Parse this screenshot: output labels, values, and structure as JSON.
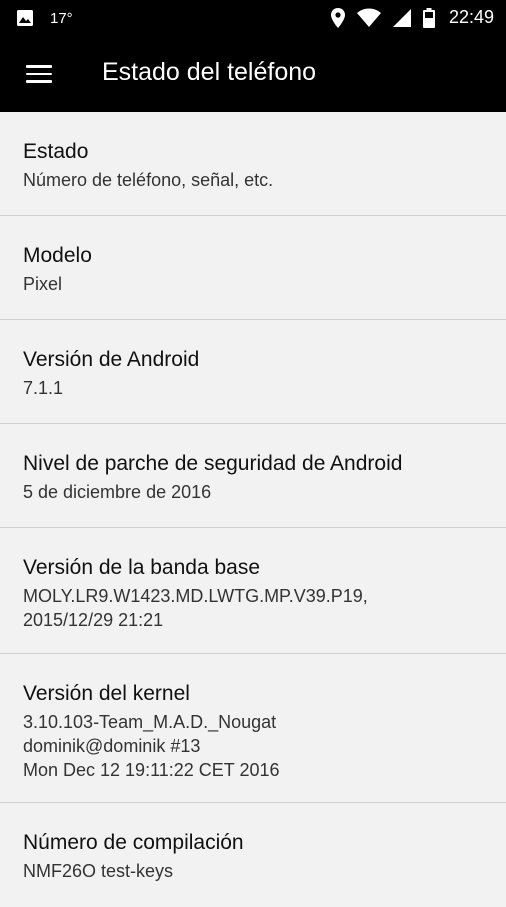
{
  "status_bar": {
    "temperature": "17°",
    "time": "22:49"
  },
  "app_bar": {
    "title": "Estado del teléfono",
    "menu_icon": "hamburger-menu-icon"
  },
  "items": [
    {
      "title": "Estado",
      "value": [
        "Número de teléfono, señal, etc."
      ]
    },
    {
      "title": "Modelo",
      "value": [
        "Pixel"
      ]
    },
    {
      "title": "Versión de Android",
      "value": [
        "7.1.1"
      ]
    },
    {
      "title": "Nivel de parche de seguridad de Android",
      "value": [
        "5 de diciembre de 2016"
      ]
    },
    {
      "title": "Versión de la banda base",
      "value": [
        "MOLY.LR9.W1423.MD.LWTG.MP.V39.P19,",
        "2015/12/29 21:21"
      ]
    },
    {
      "title": "Versión del kernel",
      "value": [
        "3.10.103-Team_M.A.D._Nougat",
        "dominik@dominik #13",
        "Mon Dec 12 19:11:22 CET 2016"
      ]
    },
    {
      "title": "Número de compilación",
      "value": [
        "NMF26O test-keys"
      ]
    }
  ]
}
